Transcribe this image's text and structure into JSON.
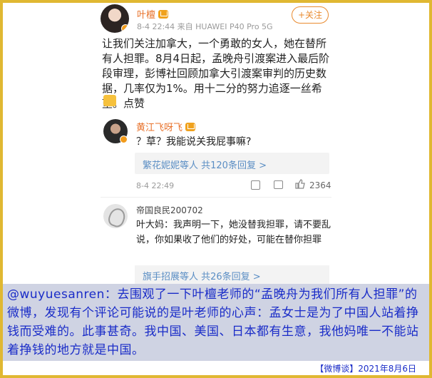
{
  "post": {
    "author": "叶檀",
    "meta": "8-4 22:44  来自 HUAWEI P40 Pro 5G",
    "follow_label": "+关注",
    "text": "让我们关注加拿大，一个勇敢的女人，她在替所有人担罪。8月4日起，孟晚舟引渡案进入最后阶段审理，彭博社回顾加拿大引渡案审判的历史数据，几率仅为1%。用十二分的努力追逐一丝希望。点赞"
  },
  "comment1": {
    "author": "黄江飞呀飞",
    "text": "？草？我能说关我屁事嘛?",
    "replies": "繁花妮妮等人 共120条回复 >",
    "time": "8-4 22:49",
    "likes": "2364"
  },
  "comment2": {
    "author": "帝国良民200702",
    "text": "叶大妈：我声明一下，她没替我担罪，请不要乱说，你如果收了他们的好处，可能在替你担罪",
    "replies": "旗手招展等人 共26条回复 >"
  },
  "note": {
    "text": "@wuyuesanren：去围观了一下叶檀老师的“孟晚舟为我们所有人担罪”的微博，发现有个评论可能说的是叶老师的心声：孟女士是为了中国人站着挣钱而受难的。此事甚奇。我中国、美国、日本都有生意，我他妈唯一不能站着挣钱的地方就是中国。",
    "footer": "【微博谈】2021年8月6日"
  },
  "colors": {
    "frame": "#e0b832",
    "username": "#e8712a",
    "link": "#5b8ec4",
    "note_text": "#1a2cc8",
    "note_bg": "#cfd3e3"
  }
}
